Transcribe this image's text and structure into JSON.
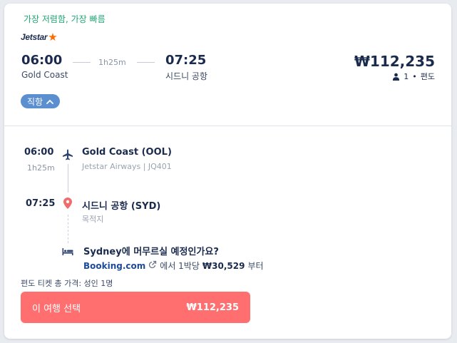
{
  "badge": "가장 저렴함, 가장 빠름",
  "airline_logo": "Jetstar",
  "summary": {
    "dep_time": "06:00",
    "dep_city": "Gold Coast",
    "duration": "1h25m",
    "arr_time": "07:25",
    "arr_city": "시드니 공항",
    "price": "₩112,235",
    "passengers": "1",
    "trip_type": "편도"
  },
  "stops_pill": "직항",
  "segment": {
    "dep_time": "06:00",
    "duration": "1h25m",
    "dep_airport": "Gold Coast (OOL)",
    "carrier": "Jetstar Airways | JQ401",
    "arr_time": "07:25",
    "arr_airport": "시드니 공항 (SYD)",
    "arr_note": "목적지"
  },
  "stay": {
    "city": "Sydney",
    "question": "에 머무르실 예정인가요?",
    "brand": "Booking.com",
    "offer": "에서 1박당",
    "offer_price": "₩30,529",
    "offer_suffix": "부터"
  },
  "total_label": "편도 티켓 총 가격: 성인 1명",
  "select_button": {
    "label": "이 여행 선택",
    "price": "₩112,235"
  },
  "colors": {
    "accent_green": "#1ea672",
    "pill_blue": "#5b8fd0",
    "cta_red": "#ff6f6f",
    "location_pin": "#f16b6b",
    "jetstar_orange": "#ff6a00"
  }
}
